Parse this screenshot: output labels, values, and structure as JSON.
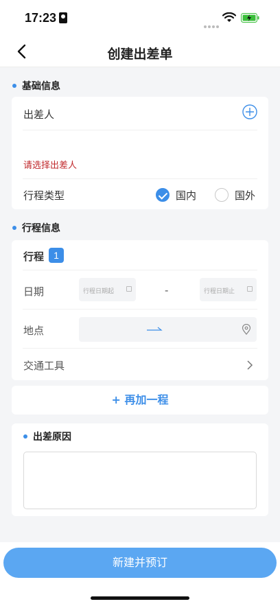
{
  "status_bar": {
    "time": "17:23"
  },
  "nav": {
    "title": "创建出差单"
  },
  "basic_info": {
    "header": "基础信息",
    "traveler_label": "出差人",
    "traveler_error": "请选择出差人",
    "trip_type_label": "行程类型",
    "options": [
      {
        "label": "国内",
        "checked": true
      },
      {
        "label": "国外",
        "checked": false
      }
    ]
  },
  "trip_info": {
    "header": "行程信息",
    "trip_title": "行程",
    "trip_number": "1",
    "date_label": "日期",
    "date_start_placeholder": "行程日期起",
    "date_separator": "-",
    "date_end_placeholder": "行程日期止",
    "location_label": "地点",
    "transport_label": "交通工具",
    "add_trip_label": "+ 再加一程"
  },
  "reason": {
    "header": "出差原因",
    "value": ""
  },
  "footer": {
    "submit_label": "新建并预订"
  },
  "colors": {
    "accent": "#3c8ee8",
    "error": "#c0292c",
    "submit": "#5ba7f2"
  }
}
